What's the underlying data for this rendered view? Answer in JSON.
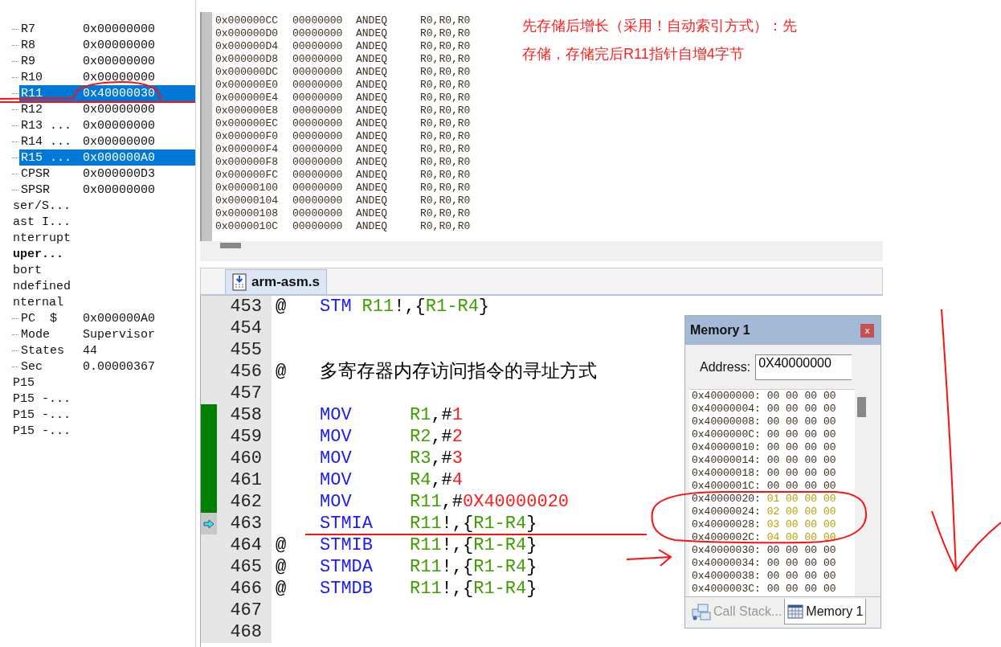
{
  "registers": [
    {
      "kind": "leaf",
      "name": "R7",
      "value": "0x00000000",
      "selected": false
    },
    {
      "kind": "leaf",
      "name": "R8",
      "value": "0x00000000",
      "selected": false
    },
    {
      "kind": "leaf",
      "name": "R9",
      "value": "0x00000000",
      "selected": false
    },
    {
      "kind": "leaf",
      "name": "R10",
      "value": "0x00000000",
      "selected": false
    },
    {
      "kind": "leaf",
      "name": "R11",
      "value": "0x40000030",
      "selected": true
    },
    {
      "kind": "leaf",
      "name": "R12",
      "value": "0x00000000",
      "selected": false
    },
    {
      "kind": "leaf",
      "name": "R13 ...",
      "value": "0x00000000",
      "selected": false
    },
    {
      "kind": "leaf",
      "name": "R14 ...",
      "value": "0x00000000",
      "selected": false
    },
    {
      "kind": "leaf",
      "name": "R15 ...",
      "value": "0x000000A0",
      "selected": true
    },
    {
      "kind": "leaf",
      "name": "CPSR",
      "value": "0x000000D3",
      "selected": false
    },
    {
      "kind": "leaf",
      "name": "SPSR",
      "value": "0x00000000",
      "selected": false
    },
    {
      "kind": "group",
      "name": "ser/S...",
      "current": false
    },
    {
      "kind": "group",
      "name": "ast I...",
      "current": false
    },
    {
      "kind": "group",
      "name": "nterrupt",
      "current": false
    },
    {
      "kind": "group",
      "name": "uper...",
      "current": true
    },
    {
      "kind": "group",
      "name": "bort",
      "current": false
    },
    {
      "kind": "group",
      "name": "ndefined",
      "current": false
    },
    {
      "kind": "group",
      "name": "nternal",
      "current": false
    },
    {
      "kind": "leaf",
      "name": "PC  $",
      "value": "0x000000A0",
      "selected": false
    },
    {
      "kind": "leaf",
      "name": "Mode",
      "value": "Supervisor",
      "selected": false
    },
    {
      "kind": "leaf",
      "name": "States",
      "value": "44",
      "selected": false
    },
    {
      "kind": "leaf",
      "name": "Sec",
      "value": "0.00000367",
      "selected": false
    },
    {
      "kind": "group",
      "name": "P15",
      "current": false
    },
    {
      "kind": "group",
      "name": "P15 -...",
      "current": false
    },
    {
      "kind": "group",
      "name": "P15 -...",
      "current": false
    },
    {
      "kind": "group",
      "name": "P15 -...",
      "current": false
    }
  ],
  "disassembly": [
    {
      "address": "0x000000CC",
      "opcode": "00000000",
      "mnemonic": "ANDEQ",
      "operands": "R0,R0,R0"
    },
    {
      "address": "0x000000D0",
      "opcode": "00000000",
      "mnemonic": "ANDEQ",
      "operands": "R0,R0,R0"
    },
    {
      "address": "0x000000D4",
      "opcode": "00000000",
      "mnemonic": "ANDEQ",
      "operands": "R0,R0,R0"
    },
    {
      "address": "0x000000D8",
      "opcode": "00000000",
      "mnemonic": "ANDEQ",
      "operands": "R0,R0,R0"
    },
    {
      "address": "0x000000DC",
      "opcode": "00000000",
      "mnemonic": "ANDEQ",
      "operands": "R0,R0,R0"
    },
    {
      "address": "0x000000E0",
      "opcode": "00000000",
      "mnemonic": "ANDEQ",
      "operands": "R0,R0,R0"
    },
    {
      "address": "0x000000E4",
      "opcode": "00000000",
      "mnemonic": "ANDEQ",
      "operands": "R0,R0,R0"
    },
    {
      "address": "0x000000E8",
      "opcode": "00000000",
      "mnemonic": "ANDEQ",
      "operands": "R0,R0,R0"
    },
    {
      "address": "0x000000EC",
      "opcode": "00000000",
      "mnemonic": "ANDEQ",
      "operands": "R0,R0,R0"
    },
    {
      "address": "0x000000F0",
      "opcode": "00000000",
      "mnemonic": "ANDEQ",
      "operands": "R0,R0,R0"
    },
    {
      "address": "0x000000F4",
      "opcode": "00000000",
      "mnemonic": "ANDEQ",
      "operands": "R0,R0,R0"
    },
    {
      "address": "0x000000F8",
      "opcode": "00000000",
      "mnemonic": "ANDEQ",
      "operands": "R0,R0,R0"
    },
    {
      "address": "0x000000FC",
      "opcode": "00000000",
      "mnemonic": "ANDEQ",
      "operands": "R0,R0,R0"
    },
    {
      "address": "0x00000100",
      "opcode": "00000000",
      "mnemonic": "ANDEQ",
      "operands": "R0,R0,R0"
    },
    {
      "address": "0x00000104",
      "opcode": "00000000",
      "mnemonic": "ANDEQ",
      "operands": "R0,R0,R0"
    },
    {
      "address": "0x00000108",
      "opcode": "00000000",
      "mnemonic": "ANDEQ",
      "operands": "R0,R0,R0"
    },
    {
      "address": "0x0000010C",
      "opcode": "00000000",
      "mnemonic": "ANDEQ",
      "operands": "R0,R0,R0"
    }
  ],
  "note": {
    "lines": [
      "先存储后增长（采用！自动索引方式）：先",
      "存储，存储完后R11指针自增4字节"
    ]
  },
  "editor": {
    "tab": {
      "label": "arm-asm.s",
      "selected": true
    },
    "lines": [
      {
        "number": "453",
        "at": "@",
        "op": "STM",
        "compact": true,
        "executed": false,
        "current": false,
        "args": [
          {
            "text": "R11",
            "kind": "register"
          },
          {
            "text": "!,{",
            "kind": "plain"
          },
          {
            "text": "R1-R4",
            "kind": "register"
          },
          {
            "text": "}",
            "kind": "plain"
          }
        ]
      },
      {
        "number": "454",
        "executed": false,
        "current": false
      },
      {
        "number": "455",
        "executed": false,
        "current": false
      },
      {
        "number": "456",
        "executed": false,
        "current": false,
        "at": "@",
        "comment": "多寄存器内存访问指令的寻址方式"
      },
      {
        "number": "457",
        "executed": false,
        "current": false
      },
      {
        "number": "458",
        "executed": true,
        "current": false,
        "op": "MOV",
        "args": [
          {
            "text": "R1",
            "kind": "register"
          },
          {
            "text": ",#",
            "kind": "plain"
          },
          {
            "text": "1",
            "kind": "number"
          }
        ]
      },
      {
        "number": "459",
        "executed": true,
        "current": false,
        "op": "MOV",
        "args": [
          {
            "text": "R2",
            "kind": "register"
          },
          {
            "text": ",#",
            "kind": "plain"
          },
          {
            "text": "2",
            "kind": "number"
          }
        ]
      },
      {
        "number": "460",
        "executed": true,
        "current": false,
        "op": "MOV",
        "args": [
          {
            "text": "R3",
            "kind": "register"
          },
          {
            "text": ",#",
            "kind": "plain"
          },
          {
            "text": "3",
            "kind": "number"
          }
        ]
      },
      {
        "number": "461",
        "executed": true,
        "current": false,
        "op": "MOV",
        "args": [
          {
            "text": "R4",
            "kind": "register"
          },
          {
            "text": ",#",
            "kind": "plain"
          },
          {
            "text": "4",
            "kind": "number"
          }
        ]
      },
      {
        "number": "462",
        "executed": true,
        "current": false,
        "op": "MOV",
        "args": [
          {
            "text": "R11",
            "kind": "register"
          },
          {
            "text": ",#",
            "kind": "plain"
          },
          {
            "text": "0X40000020",
            "kind": "number"
          }
        ]
      },
      {
        "number": "463",
        "executed": false,
        "current": true,
        "op": "STMIA",
        "args": [
          {
            "text": "R11",
            "kind": "register"
          },
          {
            "text": "!,{",
            "kind": "plain"
          },
          {
            "text": "R1-R4",
            "kind": "register"
          },
          {
            "text": "}",
            "kind": "plain"
          }
        ]
      },
      {
        "number": "464",
        "executed": false,
        "current": false,
        "at": "@",
        "op": "STMIB",
        "args": [
          {
            "text": "R11",
            "kind": "register"
          },
          {
            "text": "!,{",
            "kind": "plain"
          },
          {
            "text": "R1-R4",
            "kind": "register"
          },
          {
            "text": "}",
            "kind": "plain"
          }
        ]
      },
      {
        "number": "465",
        "executed": false,
        "current": false,
        "at": "@",
        "op": "STMDA",
        "args": [
          {
            "text": "R11",
            "kind": "register"
          },
          {
            "text": "!,{",
            "kind": "plain"
          },
          {
            "text": "R1-R4",
            "kind": "register"
          },
          {
            "text": "}",
            "kind": "plain"
          }
        ]
      },
      {
        "number": "466",
        "executed": false,
        "current": false,
        "at": "@",
        "op": "STMDB",
        "args": [
          {
            "text": "R11",
            "kind": "register"
          },
          {
            "text": "!,{",
            "kind": "plain"
          },
          {
            "text": "R1-R4",
            "kind": "register"
          },
          {
            "text": "}",
            "kind": "plain"
          }
        ]
      },
      {
        "number": "467",
        "executed": false,
        "current": false
      },
      {
        "number": "468",
        "executed": false,
        "current": false
      }
    ]
  },
  "memory": {
    "title": "Memory 1",
    "close": "x",
    "address_label": "Address:",
    "address": "0X40000000",
    "rows": [
      {
        "address": "0x40000000:",
        "bytes": [
          "00",
          "00",
          "00",
          "00"
        ],
        "changed": false
      },
      {
        "address": "0x40000004:",
        "bytes": [
          "00",
          "00",
          "00",
          "00"
        ],
        "changed": false
      },
      {
        "address": "0x40000008:",
        "bytes": [
          "00",
          "00",
          "00",
          "00"
        ],
        "changed": false
      },
      {
        "address": "0x4000000C:",
        "bytes": [
          "00",
          "00",
          "00",
          "00"
        ],
        "changed": false
      },
      {
        "address": "0x40000010:",
        "bytes": [
          "00",
          "00",
          "00",
          "00"
        ],
        "changed": false
      },
      {
        "address": "0x40000014:",
        "bytes": [
          "00",
          "00",
          "00",
          "00"
        ],
        "changed": false
      },
      {
        "address": "0x40000018:",
        "bytes": [
          "00",
          "00",
          "00",
          "00"
        ],
        "changed": false
      },
      {
        "address": "0x4000001C:",
        "bytes": [
          "00",
          "00",
          "00",
          "00"
        ],
        "changed": false
      },
      {
        "address": "0x40000020:",
        "bytes": [
          "01",
          "00",
          "00",
          "00"
        ],
        "changed": true
      },
      {
        "address": "0x40000024:",
        "bytes": [
          "02",
          "00",
          "00",
          "00"
        ],
        "changed": true
      },
      {
        "address": "0x40000028:",
        "bytes": [
          "03",
          "00",
          "00",
          "00"
        ],
        "changed": true
      },
      {
        "address": "0x4000002C:",
        "bytes": [
          "04",
          "00",
          "00",
          "00"
        ],
        "changed": true
      },
      {
        "address": "0x40000030:",
        "bytes": [
          "00",
          "00",
          "00",
          "00"
        ],
        "changed": false
      },
      {
        "address": "0x40000034:",
        "bytes": [
          "00",
          "00",
          "00",
          "00"
        ],
        "changed": false
      },
      {
        "address": "0x40000038:",
        "bytes": [
          "00",
          "00",
          "00",
          "00"
        ],
        "changed": false
      },
      {
        "address": "0x4000003C:",
        "bytes": [
          "00",
          "00",
          "00",
          "00"
        ],
        "changed": false
      }
    ],
    "tabs": [
      {
        "label": "Call Stack...",
        "kind": "stack",
        "selected": false
      },
      {
        "label": "Memory 1",
        "kind": "memory",
        "selected": true
      }
    ]
  }
}
